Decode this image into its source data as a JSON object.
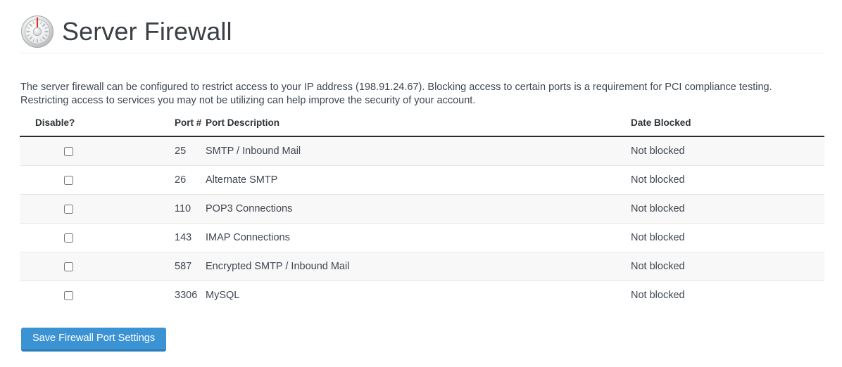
{
  "header": {
    "title": "Server Firewall",
    "icon": "gauge-icon"
  },
  "intro": {
    "text": "The server firewall can be configured to restrict access to your IP address (198.91.24.67). Blocking access to certain ports is a requirement for PCI compliance testing. Restricting access to services you may not be utilizing can help improve the security of your account.",
    "ip_address": "198.91.24.67"
  },
  "table": {
    "columns": [
      {
        "key": "disable",
        "label": "Disable?"
      },
      {
        "key": "port",
        "label": "Port #"
      },
      {
        "key": "description",
        "label": "Port Description"
      },
      {
        "key": "date_blocked",
        "label": "Date Blocked"
      }
    ],
    "rows": [
      {
        "checked": false,
        "port": "25",
        "description": "SMTP / Inbound Mail",
        "date_blocked": "Not blocked"
      },
      {
        "checked": false,
        "port": "26",
        "description": "Alternate SMTP",
        "date_blocked": "Not blocked"
      },
      {
        "checked": false,
        "port": "110",
        "description": "POP3 Connections",
        "date_blocked": "Not blocked"
      },
      {
        "checked": false,
        "port": "143",
        "description": "IMAP Connections",
        "date_blocked": "Not blocked"
      },
      {
        "checked": false,
        "port": "587",
        "description": "Encrypted SMTP / Inbound Mail",
        "date_blocked": "Not blocked"
      },
      {
        "checked": false,
        "port": "3306",
        "description": "MySQL",
        "date_blocked": "Not blocked"
      }
    ]
  },
  "actions": {
    "save_label": "Save Firewall Port Settings"
  },
  "colors": {
    "button": "#3c93d4",
    "button_border": "#2c7db8",
    "title": "#3b4044",
    "text": "#3f4750",
    "row_stripe": "#f8f8f8",
    "header_rule": "#2b2b2b",
    "row_rule": "#e6e7e8",
    "needle": "#d9342b"
  }
}
